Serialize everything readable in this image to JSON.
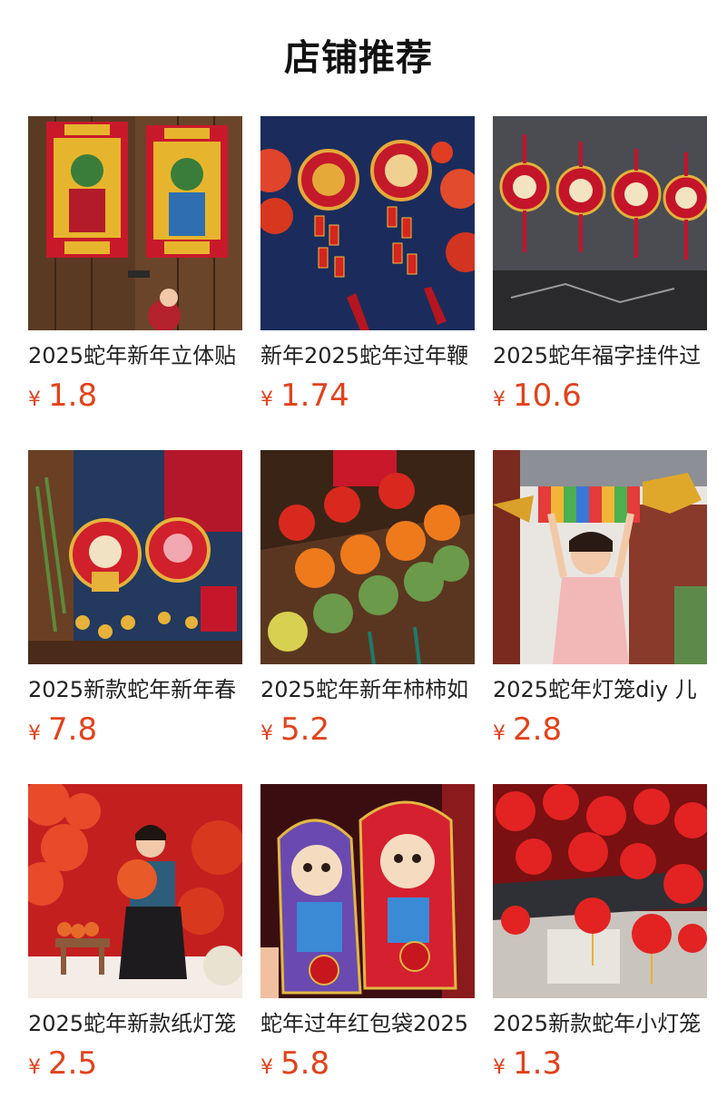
{
  "header": {
    "title": "店铺推荐"
  },
  "colors": {
    "price": "#e2421b",
    "title": "#111111"
  },
  "products": [
    {
      "name": "2025蛇年新年立体贴",
      "currency": "¥",
      "price": "1.8",
      "image_icon": "door-god-couplet-image"
    },
    {
      "name": "新年2025蛇年过年鞭",
      "currency": "¥",
      "price": "1.74",
      "image_icon": "firecracker-pendant-image"
    },
    {
      "name": "2025蛇年福字挂件过",
      "currency": "¥",
      "price": "10.6",
      "image_icon": "xin-nian-kuai-le-pendants-image"
    },
    {
      "name": "2025新款蛇年新年春",
      "currency": "¥",
      "price": "7.8",
      "image_icon": "lion-pendant-image"
    },
    {
      "name": "2025蛇年新年柿柿如",
      "currency": "¥",
      "price": "5.2",
      "image_icon": "persimmon-ornaments-image"
    },
    {
      "name": "2025蛇年灯笼diy 儿",
      "currency": "¥",
      "price": "2.8",
      "image_icon": "dragon-lantern-child-image"
    },
    {
      "name": "2025蛇年新款纸灯笼",
      "currency": "¥",
      "price": "2.5",
      "image_icon": "paper-lanterns-child-image"
    },
    {
      "name": "蛇年过年红包袋2025",
      "currency": "¥",
      "price": "5.8",
      "image_icon": "red-envelope-bags-image"
    },
    {
      "name": "2025新款蛇年小灯笼",
      "currency": "¥",
      "price": "1.3",
      "image_icon": "small-lanterns-image"
    }
  ]
}
